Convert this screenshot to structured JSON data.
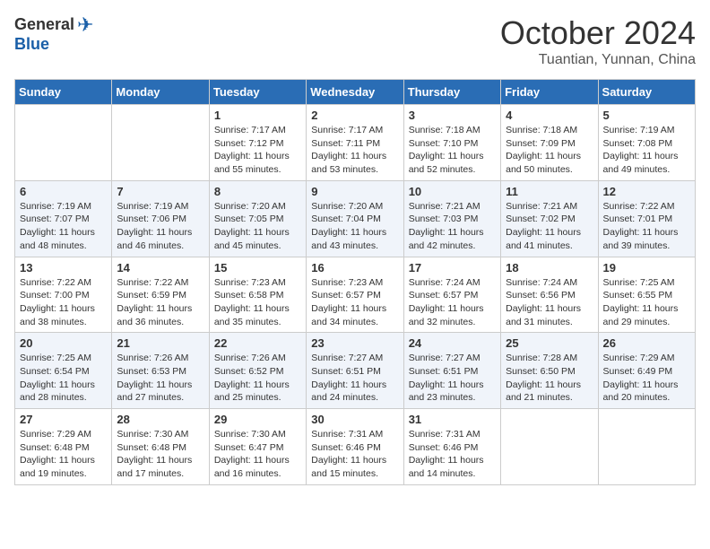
{
  "logo": {
    "general": "General",
    "blue": "Blue"
  },
  "title": "October 2024",
  "subtitle": "Tuantian, Yunnan, China",
  "days_header": [
    "Sunday",
    "Monday",
    "Tuesday",
    "Wednesday",
    "Thursday",
    "Friday",
    "Saturday"
  ],
  "weeks": [
    [
      {
        "day": "",
        "info": ""
      },
      {
        "day": "",
        "info": ""
      },
      {
        "day": "1",
        "info": "Sunrise: 7:17 AM\nSunset: 7:12 PM\nDaylight: 11 hours and 55 minutes."
      },
      {
        "day": "2",
        "info": "Sunrise: 7:17 AM\nSunset: 7:11 PM\nDaylight: 11 hours and 53 minutes."
      },
      {
        "day": "3",
        "info": "Sunrise: 7:18 AM\nSunset: 7:10 PM\nDaylight: 11 hours and 52 minutes."
      },
      {
        "day": "4",
        "info": "Sunrise: 7:18 AM\nSunset: 7:09 PM\nDaylight: 11 hours and 50 minutes."
      },
      {
        "day": "5",
        "info": "Sunrise: 7:19 AM\nSunset: 7:08 PM\nDaylight: 11 hours and 49 minutes."
      }
    ],
    [
      {
        "day": "6",
        "info": "Sunrise: 7:19 AM\nSunset: 7:07 PM\nDaylight: 11 hours and 48 minutes."
      },
      {
        "day": "7",
        "info": "Sunrise: 7:19 AM\nSunset: 7:06 PM\nDaylight: 11 hours and 46 minutes."
      },
      {
        "day": "8",
        "info": "Sunrise: 7:20 AM\nSunset: 7:05 PM\nDaylight: 11 hours and 45 minutes."
      },
      {
        "day": "9",
        "info": "Sunrise: 7:20 AM\nSunset: 7:04 PM\nDaylight: 11 hours and 43 minutes."
      },
      {
        "day": "10",
        "info": "Sunrise: 7:21 AM\nSunset: 7:03 PM\nDaylight: 11 hours and 42 minutes."
      },
      {
        "day": "11",
        "info": "Sunrise: 7:21 AM\nSunset: 7:02 PM\nDaylight: 11 hours and 41 minutes."
      },
      {
        "day": "12",
        "info": "Sunrise: 7:22 AM\nSunset: 7:01 PM\nDaylight: 11 hours and 39 minutes."
      }
    ],
    [
      {
        "day": "13",
        "info": "Sunrise: 7:22 AM\nSunset: 7:00 PM\nDaylight: 11 hours and 38 minutes."
      },
      {
        "day": "14",
        "info": "Sunrise: 7:22 AM\nSunset: 6:59 PM\nDaylight: 11 hours and 36 minutes."
      },
      {
        "day": "15",
        "info": "Sunrise: 7:23 AM\nSunset: 6:58 PM\nDaylight: 11 hours and 35 minutes."
      },
      {
        "day": "16",
        "info": "Sunrise: 7:23 AM\nSunset: 6:57 PM\nDaylight: 11 hours and 34 minutes."
      },
      {
        "day": "17",
        "info": "Sunrise: 7:24 AM\nSunset: 6:57 PM\nDaylight: 11 hours and 32 minutes."
      },
      {
        "day": "18",
        "info": "Sunrise: 7:24 AM\nSunset: 6:56 PM\nDaylight: 11 hours and 31 minutes."
      },
      {
        "day": "19",
        "info": "Sunrise: 7:25 AM\nSunset: 6:55 PM\nDaylight: 11 hours and 29 minutes."
      }
    ],
    [
      {
        "day": "20",
        "info": "Sunrise: 7:25 AM\nSunset: 6:54 PM\nDaylight: 11 hours and 28 minutes."
      },
      {
        "day": "21",
        "info": "Sunrise: 7:26 AM\nSunset: 6:53 PM\nDaylight: 11 hours and 27 minutes."
      },
      {
        "day": "22",
        "info": "Sunrise: 7:26 AM\nSunset: 6:52 PM\nDaylight: 11 hours and 25 minutes."
      },
      {
        "day": "23",
        "info": "Sunrise: 7:27 AM\nSunset: 6:51 PM\nDaylight: 11 hours and 24 minutes."
      },
      {
        "day": "24",
        "info": "Sunrise: 7:27 AM\nSunset: 6:51 PM\nDaylight: 11 hours and 23 minutes."
      },
      {
        "day": "25",
        "info": "Sunrise: 7:28 AM\nSunset: 6:50 PM\nDaylight: 11 hours and 21 minutes."
      },
      {
        "day": "26",
        "info": "Sunrise: 7:29 AM\nSunset: 6:49 PM\nDaylight: 11 hours and 20 minutes."
      }
    ],
    [
      {
        "day": "27",
        "info": "Sunrise: 7:29 AM\nSunset: 6:48 PM\nDaylight: 11 hours and 19 minutes."
      },
      {
        "day": "28",
        "info": "Sunrise: 7:30 AM\nSunset: 6:48 PM\nDaylight: 11 hours and 17 minutes."
      },
      {
        "day": "29",
        "info": "Sunrise: 7:30 AM\nSunset: 6:47 PM\nDaylight: 11 hours and 16 minutes."
      },
      {
        "day": "30",
        "info": "Sunrise: 7:31 AM\nSunset: 6:46 PM\nDaylight: 11 hours and 15 minutes."
      },
      {
        "day": "31",
        "info": "Sunrise: 7:31 AM\nSunset: 6:46 PM\nDaylight: 11 hours and 14 minutes."
      },
      {
        "day": "",
        "info": ""
      },
      {
        "day": "",
        "info": ""
      }
    ]
  ]
}
